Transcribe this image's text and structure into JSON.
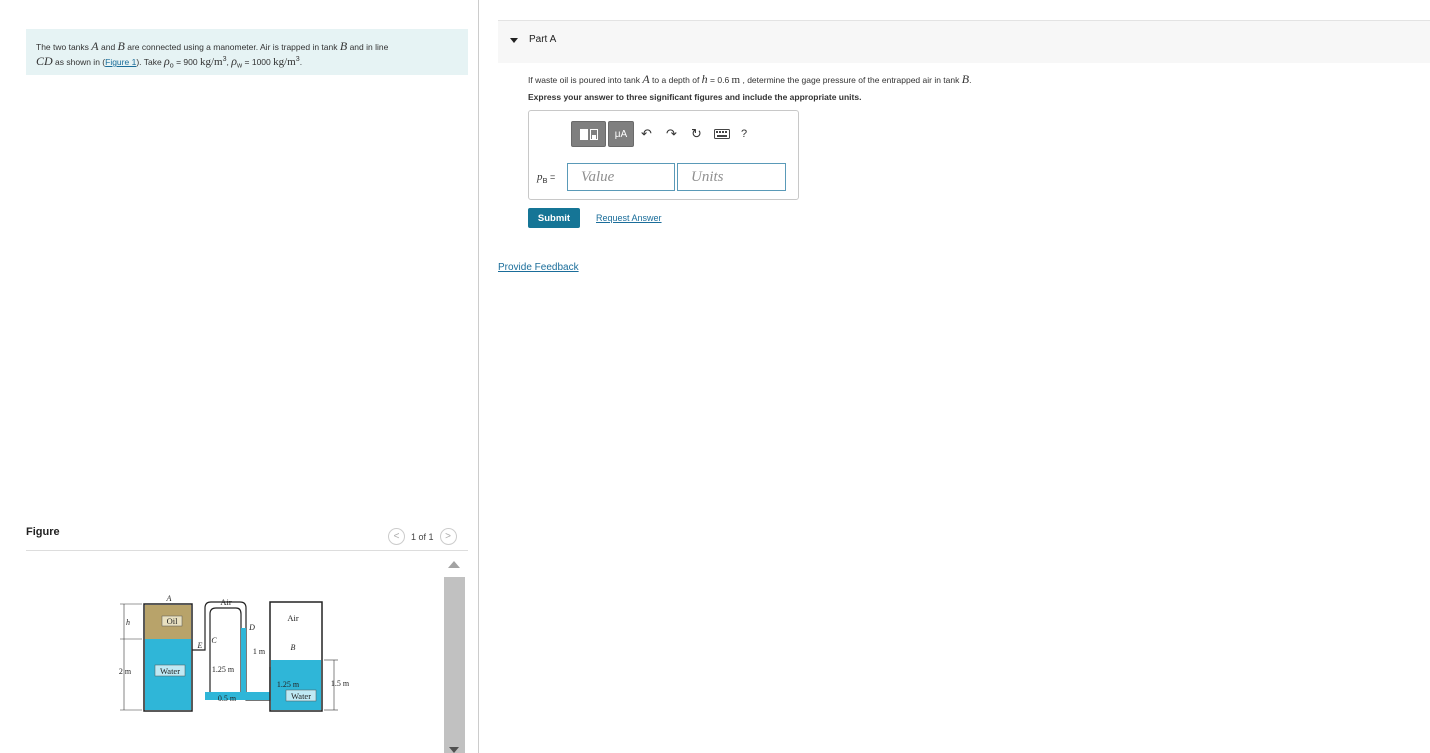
{
  "problem": {
    "text_before_A": "The two tanks ",
    "var_A": "A",
    "text_and": " and ",
    "var_B": "B",
    "text_after_B": " are connected using a manometer. Air is trapped in tank ",
    "var_B2": "B",
    "text_line": " and in line",
    "var_CD": "CD",
    "text_shown": " as shown in (",
    "figure_link": "Figure 1",
    "text_take": "). Take ",
    "rho_o_sym": "ρ",
    "rho_o_sub": "o",
    "rho_o_val": " = 900 ",
    "unit_kgm3": "kg/m",
    "cube": "3",
    "sep": ", ",
    "rho_w_sym": "ρ",
    "rho_w_sub": "w",
    "rho_w_val": " = 1000 ",
    "unit_kgm3_2": "kg/m",
    "cube2": "3",
    "period": "."
  },
  "figure": {
    "title": "Figure",
    "pager_count": "1 of 1",
    "prev_glyph": "<",
    "next_glyph": ">",
    "labels": {
      "A": "A",
      "air_top": "Air",
      "air_b": "Air",
      "D": "D",
      "C": "C",
      "E": "E",
      "oil": "Oil",
      "h": "h",
      "one_m": "1 m",
      "B": "B",
      "two_m": "2 m",
      "water_a": "Water",
      "one25_left": "1.25 m",
      "one25_right": "1.25 m",
      "one5": "1.5 m",
      "half_m": "0.5 m",
      "water_b": "Water"
    }
  },
  "part": {
    "title": "Part A",
    "q_before": "If waste oil is poured into tank ",
    "q_A": "A",
    "q_mid": " to a depth of ",
    "q_h": "h",
    "q_eq": " = 0.6 ",
    "q_m": "m",
    "q_after": " , determine the gage pressure of the entrapped air in tank ",
    "q_B": "B",
    "q_end": ".",
    "instruction": "Express your answer to three significant figures and include the appropriate units.",
    "toolbar": {
      "units_label": "μA",
      "undo": "↶",
      "redo": "↷",
      "reset": "↻",
      "help": "?"
    },
    "answer_label_sym": "p",
    "answer_label_sub": "B",
    "answer_label_eq": " =",
    "value_placeholder": "Value",
    "units_placeholder": "Units",
    "submit": "Submit",
    "request_answer": "Request Answer"
  },
  "feedback": "Provide Feedback",
  "colors": {
    "problem_bg": "#e6f3f4",
    "link": "#1a6d9a",
    "submit_bg": "#157596",
    "water": "#2fb6d8",
    "oil": "#b8a36a"
  }
}
